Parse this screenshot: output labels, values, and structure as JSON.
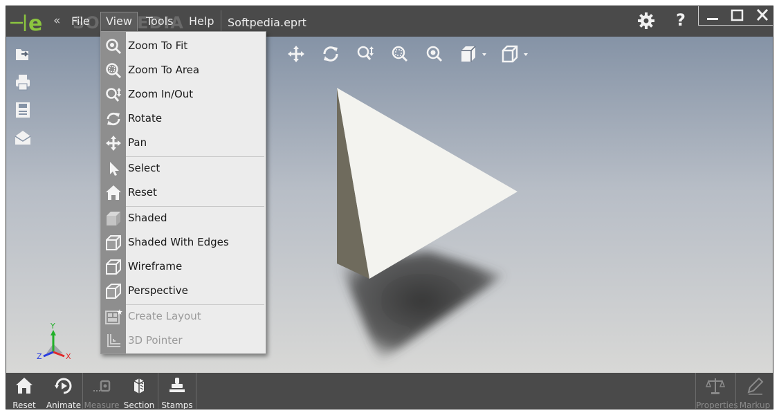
{
  "titlebar": {
    "menus": [
      "File",
      "View",
      "Tools",
      "Help"
    ],
    "collapse_glyph": "«",
    "document_title": "Softpedia.eprt",
    "watermark": "SOFTPEDIA",
    "help_glyph": "?",
    "icons": [
      "logo-icon",
      "gear-icon",
      "minimize-icon",
      "maximize-icon",
      "close-icon"
    ]
  },
  "view_menu": {
    "items": [
      {
        "label": "Zoom To Fit",
        "icon": "zoom-fit-icon",
        "enabled": true
      },
      {
        "label": "Zoom To Area",
        "icon": "zoom-area-icon",
        "enabled": true
      },
      {
        "label": "Zoom In/Out",
        "icon": "zoom-inout-icon",
        "enabled": true
      },
      {
        "label": "Rotate",
        "icon": "rotate-icon",
        "enabled": true
      },
      {
        "label": "Pan",
        "icon": "pan-icon",
        "enabled": true
      },
      {
        "label": "Select",
        "icon": "select-arrow-icon",
        "enabled": true
      },
      {
        "label": "Reset",
        "icon": "home-icon",
        "enabled": true
      },
      {
        "label": "Shaded",
        "icon": "shaded-cube-icon",
        "enabled": true
      },
      {
        "label": "Shaded With Edges",
        "icon": "shaded-edges-cube-icon",
        "enabled": true
      },
      {
        "label": "Wireframe",
        "icon": "wireframe-cube-icon",
        "enabled": true
      },
      {
        "label": "Perspective",
        "icon": "perspective-cube-icon",
        "enabled": true
      },
      {
        "label": "Create Layout",
        "icon": "layout-icon",
        "enabled": false
      },
      {
        "label": "3D Pointer",
        "icon": "pointer-3d-icon",
        "enabled": false
      }
    ]
  },
  "viewport_toolbar": {
    "icons": [
      "pan-icon",
      "rotate-icon",
      "zoom-inout-icon",
      "zoom-area-icon",
      "zoom-fit-icon",
      "view-orientation-icon",
      "display-style-icon"
    ]
  },
  "left_toolbar": {
    "icons": [
      "open-icon",
      "print-icon",
      "save-icon",
      "email-icon"
    ]
  },
  "triad": {
    "x": "X",
    "y": "Y",
    "z": "Z"
  },
  "bottom_toolbar": {
    "left": [
      {
        "label": "Reset",
        "icon": "home-icon",
        "enabled": true
      },
      {
        "label": "Animate",
        "icon": "animate-icon",
        "enabled": true
      },
      {
        "label": "Measure",
        "icon": "measure-icon",
        "enabled": false
      },
      {
        "label": "Section",
        "icon": "section-icon",
        "enabled": true
      },
      {
        "label": "Stamps",
        "icon": "stamp-icon",
        "enabled": true
      }
    ],
    "right": [
      {
        "label": "Properties",
        "icon": "scales-icon",
        "enabled": false
      },
      {
        "label": "Markup",
        "icon": "pen-icon",
        "enabled": false
      }
    ]
  },
  "colors": {
    "chrome": "#4a4a4a",
    "logo_green": "#8cc63f",
    "menu_bg": "#ececec",
    "menu_gutter": "#8e8e8e",
    "model_face": "#f2f2ee",
    "model_side": "#706c5e"
  }
}
